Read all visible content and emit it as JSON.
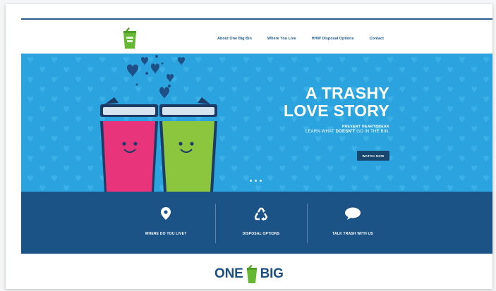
{
  "nav": {
    "items": [
      "About One Big Bin",
      "Where You Live",
      "HHW Disposal Options",
      "Contact"
    ]
  },
  "hero": {
    "title_line1": "A TRASHY",
    "title_line2": "LOVE STORY",
    "subtitle1": "PREVENT HEARTBREAK",
    "subtitle2_pre": "LEARN WHAT ",
    "subtitle2_bold": "DOESN'T",
    "subtitle2_post": " GO IN THE BIN.",
    "button_label": "WATCH NOW",
    "slide_count": 3
  },
  "features": [
    {
      "label": "WHERE DO YOU LIVE?",
      "icon": "map-pin-icon"
    },
    {
      "label": "DISPOSAL OPTIONS",
      "icon": "recycle-icon"
    },
    {
      "label": "TALK TRASH WITH US",
      "icon": "speech-bubble-icon"
    }
  ],
  "footer_logo": {
    "word1": "ONE",
    "word2": "BIG"
  },
  "colors": {
    "hero_bg": "#2ba3de",
    "band_bg": "#1c5386",
    "button_bg": "#17466f",
    "pink_bin": "#e8347a",
    "green_bin": "#8cc63f",
    "logo_green": "#66b832",
    "nav_text": "#1e5a8c"
  }
}
